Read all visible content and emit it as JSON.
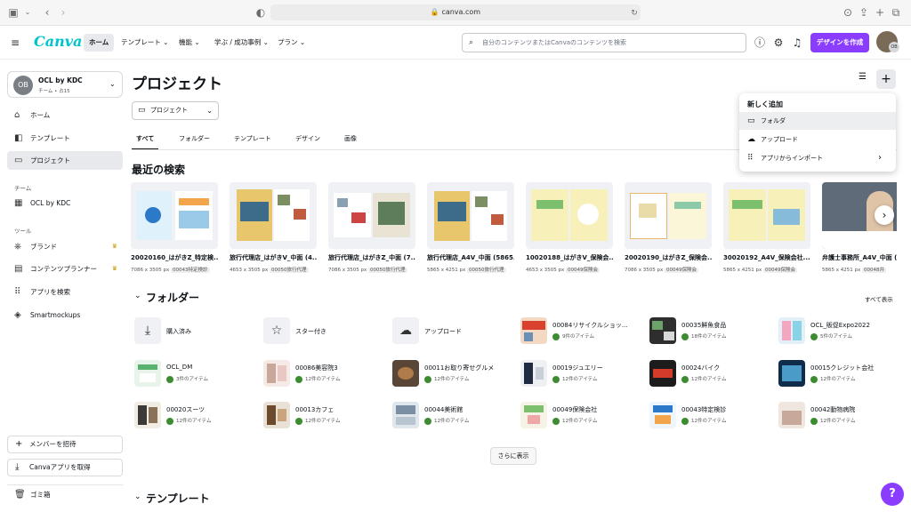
{
  "browser": {
    "url": "canva.com"
  },
  "nav": {
    "logo": "Canva",
    "items": [
      {
        "label": "ホーム"
      },
      {
        "label": "テンプレート ⌄"
      },
      {
        "label": "機能 ⌄"
      },
      {
        "label": "学ぶ / 成功事例 ⌄"
      },
      {
        "label": "プラン ⌄"
      }
    ],
    "search_placeholder": "自分のコンテンツまたはCanvaのコンテンツを検索",
    "create_label": "デザインを作成",
    "avatar_initials": "OB"
  },
  "sidebar": {
    "team_name": "OCL by KDC",
    "team_sub": "チーム • 占15",
    "team_initials": "OB",
    "items": [
      {
        "label": "ホーム"
      },
      {
        "label": "テンプレート"
      },
      {
        "label": "プロジェクト"
      }
    ],
    "team_heading": "チーム",
    "team_item": "OCL by KDC",
    "tools_heading": "ツール",
    "tools": [
      {
        "label": "ブランド"
      },
      {
        "label": "コンテンツプランナー"
      },
      {
        "label": "アプリを検索"
      },
      {
        "label": "Smartmockups"
      }
    ],
    "invite_label": "メンバーを招待",
    "download_label": "Canvaアプリを取得",
    "trash_label": "ゴミ箱"
  },
  "main": {
    "title": "プロジェクト",
    "filter": "プロジェクト",
    "tabs": [
      "すべて",
      "フォルダー",
      "テンプレート",
      "デザイン",
      "画像"
    ],
    "recent_heading": "最近の検索",
    "recent": [
      {
        "title": "20020160_はがきZ_特定検...",
        "size": "7086 x 3505 px",
        "tag": "00043特定検診"
      },
      {
        "title": "旅行代理店_はがきV_中面 (4...",
        "size": "4653 x 3505 px",
        "tag": "00050旅行代理"
      },
      {
        "title": "旅行代理店_はがきZ_中面 (7...",
        "size": "7086 x 3505 px",
        "tag": "00050旅行代理"
      },
      {
        "title": "旅行代理店_A4V_中面 (5865...",
        "size": "5865 x 4251 px",
        "tag": "00050旅行代理"
      },
      {
        "title": "10020188_はがきV_保険会...",
        "size": "4653 x 3505 px",
        "tag": "00049保険会"
      },
      {
        "title": "20020190_はがきZ_保険会...",
        "size": "7086 x 3505 px",
        "tag": "00049保険会"
      },
      {
        "title": "30020192_A4V_保険会社...",
        "size": "5865 x 4251 px",
        "tag": "00049保険会"
      },
      {
        "title": "弁護士事務所_A4V_中面 (5",
        "size": "5865 x 4251 px",
        "tag": "00048弁"
      }
    ],
    "folders_heading": "フォルダー",
    "show_all": "すべて表示",
    "folders": [
      {
        "name": "購入済み",
        "sub": ""
      },
      {
        "name": "スター付き",
        "sub": ""
      },
      {
        "name": "アップロード",
        "sub": ""
      },
      {
        "name": "00084リサイクルショッ...",
        "sub": "9件のアイテム"
      },
      {
        "name": "00035鮮魚食品",
        "sub": "18件のアイテム"
      },
      {
        "name": "OCL_販促Expo2022",
        "sub": "5件のアイテム"
      },
      {
        "name": "OCL_DM",
        "sub": "3件のアイテム"
      },
      {
        "name": "00086美容院3",
        "sub": "12件のアイテム"
      },
      {
        "name": "00011お取り寄せグルメ",
        "sub": "12件のアイテム"
      },
      {
        "name": "00019ジュエリー",
        "sub": "12件のアイテム"
      },
      {
        "name": "00024バイク",
        "sub": "12件のアイテム"
      },
      {
        "name": "00015クレジット会社",
        "sub": "12件のアイテム"
      },
      {
        "name": "00020スーツ",
        "sub": "12件のアイテム"
      },
      {
        "name": "00013カフェ",
        "sub": "12件のアイテム"
      },
      {
        "name": "00044美術館",
        "sub": "12件のアイテム"
      },
      {
        "name": "00049保険会社",
        "sub": "12件のアイテム"
      },
      {
        "name": "00043特定検診",
        "sub": "12件のアイテム"
      },
      {
        "name": "00042動物病院",
        "sub": "12件のアイテム"
      }
    ],
    "more_label": "さらに表示",
    "templates_heading": "テンプレート"
  },
  "new_menu": {
    "heading": "新しく追加",
    "items": [
      {
        "label": "フォルダ"
      },
      {
        "label": "アップロード"
      },
      {
        "label": "アプリからインポート"
      }
    ]
  },
  "help_label": "?",
  "colors": {
    "accent": "#8b3dff",
    "logo": "#00c4cc"
  }
}
